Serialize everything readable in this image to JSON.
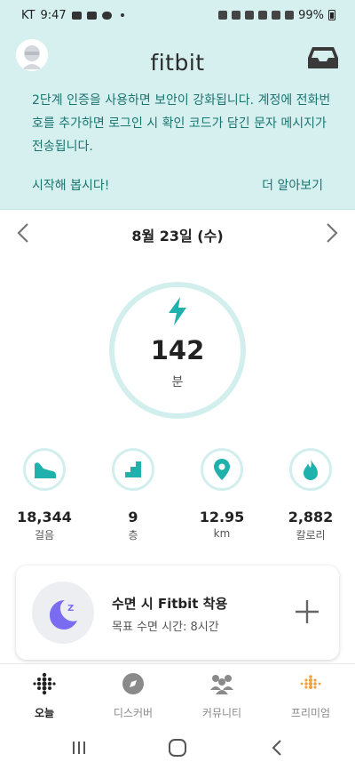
{
  "status_bar": {
    "carrier": "KT",
    "time": "9:47",
    "battery": "99%"
  },
  "app": {
    "title": "fitbit"
  },
  "banner": {
    "message": "2단계 인증을 사용하면 보안이 강화됩니다. 계정에 전화번호를 추가하면 로그인 시 확인 코드가 담긴 문자 메시지가 전송됩니다.",
    "start_link": "시작해 봅시다!",
    "learn_more_link": "더 알아보기"
  },
  "date": {
    "label": "8월 23일 (수)"
  },
  "active_zone": {
    "value": "142",
    "unit": "분"
  },
  "stats": [
    {
      "value": "18,344",
      "unit": "걸음",
      "icon": "shoe-icon"
    },
    {
      "value": "9",
      "unit": "층",
      "icon": "stairs-icon"
    },
    {
      "value": "12.95",
      "unit": "km",
      "icon": "location-pin-icon"
    },
    {
      "value": "2,882",
      "unit": "칼로리",
      "icon": "flame-icon"
    }
  ],
  "sleep_card": {
    "title": "수면 시 Fitbit 착용",
    "subtitle": "목표 수면 시간: 8시간"
  },
  "bottom_nav": [
    {
      "label": "오늘",
      "active": true
    },
    {
      "label": "디스커버",
      "active": false
    },
    {
      "label": "커뮤니티",
      "active": false
    },
    {
      "label": "프리미엄",
      "active": false
    }
  ],
  "colors": {
    "header_bg": "#d6f0ef",
    "teal_accent": "#1fb1ac",
    "banner_text": "#1a7470",
    "sleep_purple": "#7a6cf0",
    "premium_orange": "#f0a040"
  }
}
